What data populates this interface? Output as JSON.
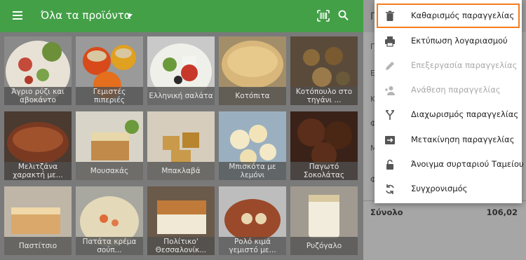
{
  "topbar": {
    "category_title": "Όλα τα προϊόντα",
    "icons": [
      "menu-icon",
      "chevron-down-icon",
      "barcode-icon",
      "search-icon"
    ],
    "color": "#43a047"
  },
  "products": [
    {
      "label": "Άγριο ρύζι και αβοκάντο",
      "icon": "food-photo"
    },
    {
      "label": "Γεμιστές πιπεριές",
      "icon": "food-photo"
    },
    {
      "label": "Ελληνική σαλάτα",
      "icon": "food-photo"
    },
    {
      "label": "Κοτόπιτα",
      "icon": "food-photo"
    },
    {
      "label": "Κοτόπουλο στο τηγάνι ...",
      "icon": "food-photo"
    },
    {
      "label": "Μελιτζάνα χαρακτή με...",
      "icon": "food-photo"
    },
    {
      "label": "Μουσακάς",
      "icon": "food-photo"
    },
    {
      "label": "Μπακλαβά",
      "icon": "food-photo"
    },
    {
      "label": "Μπισκότα με λεμόνι",
      "icon": "food-photo"
    },
    {
      "label": "Παγωτό Σοκολάτας",
      "icon": "food-photo"
    },
    {
      "label": "Παστίτσιο",
      "icon": "food-photo"
    },
    {
      "label": "Πατάτα κρέμα σούπ...",
      "icon": "food-photo"
    },
    {
      "label": "Πολίτικο' Θεσσαλονίκ...",
      "icon": "food-photo"
    },
    {
      "label": "Ρολό κιμά γεμιστό με...",
      "icon": "food-photo"
    },
    {
      "label": "Ρυζόγαλο",
      "icon": "food-photo"
    }
  ],
  "order_panel": {
    "header_initial": "Π",
    "rows": [
      "Π",
      "Ε",
      "Κ",
      "Φ",
      "Μ",
      "Φ"
    ],
    "total_label": "Σύνολο",
    "total_value": "106,02"
  },
  "menu": {
    "items": [
      {
        "label": "Καθαρισμός παραγγελίας",
        "icon": "trash-icon",
        "disabled": false,
        "highlighted": true
      },
      {
        "label": "Εκτύπωση λογαριασμού",
        "icon": "printer-icon",
        "disabled": false,
        "highlighted": false
      },
      {
        "label": "Επεξεργασία παραγγελίας",
        "icon": "pencil-icon",
        "disabled": true,
        "highlighted": false
      },
      {
        "label": "Ανάθεση παραγγελίας",
        "icon": "assign-person-icon",
        "disabled": true,
        "highlighted": false
      },
      {
        "label": "Διαχωρισμός παραγγελίας",
        "icon": "split-icon",
        "disabled": false,
        "highlighted": false
      },
      {
        "label": "Μετακίνηση παραγγελίας",
        "icon": "move-icon",
        "disabled": false,
        "highlighted": false
      },
      {
        "label": "Άνοιγμα συρταριού Ταμείου",
        "icon": "unlock-icon",
        "disabled": false,
        "highlighted": false
      },
      {
        "label": "Συγχρονισμός",
        "icon": "sync-icon",
        "disabled": false,
        "highlighted": false
      }
    ],
    "highlight_color": "#f57c1f"
  }
}
